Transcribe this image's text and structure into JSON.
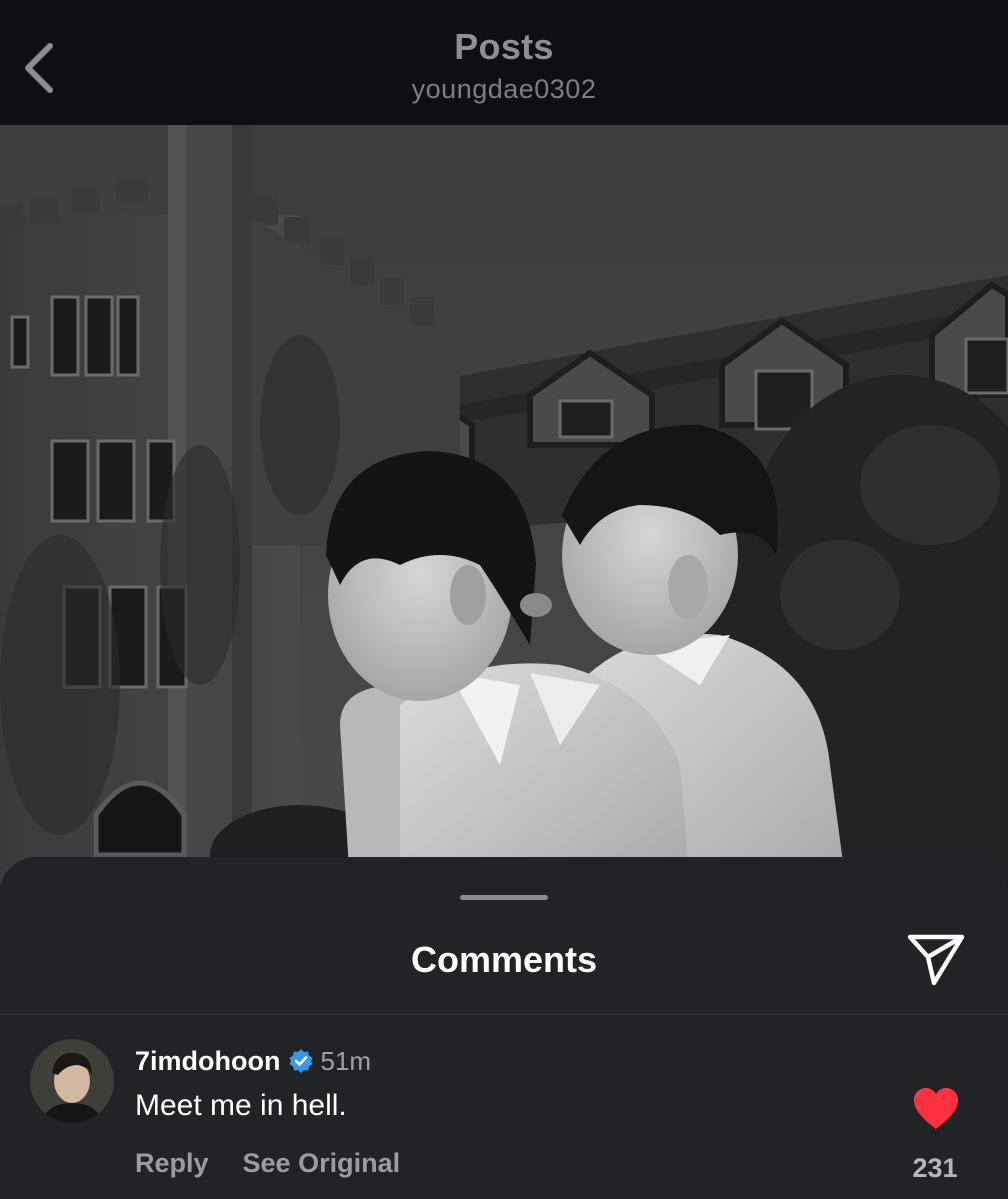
{
  "header": {
    "back_icon": "chevron-left-icon",
    "title": "Posts",
    "subtitle": "youngdae0302"
  },
  "post": {
    "photo_kind": "photo",
    "photo_tone": "grayscale"
  },
  "comments_sheet": {
    "title": "Comments",
    "share_icon": "paper-plane-icon",
    "comments": [
      {
        "username": "7imdohoon",
        "verified": true,
        "verified_icon": "verified-badge-icon",
        "time": "51m",
        "text": "Meet me in hell.",
        "actions": {
          "reply": "Reply",
          "see_original": "See Original"
        },
        "like_icon": "heart-icon",
        "liked": true,
        "likes": "231"
      }
    ]
  },
  "colors": {
    "background": "#0d0f13",
    "sheet": "#222327",
    "verified": "#3897f0",
    "like": "#ff3040"
  }
}
